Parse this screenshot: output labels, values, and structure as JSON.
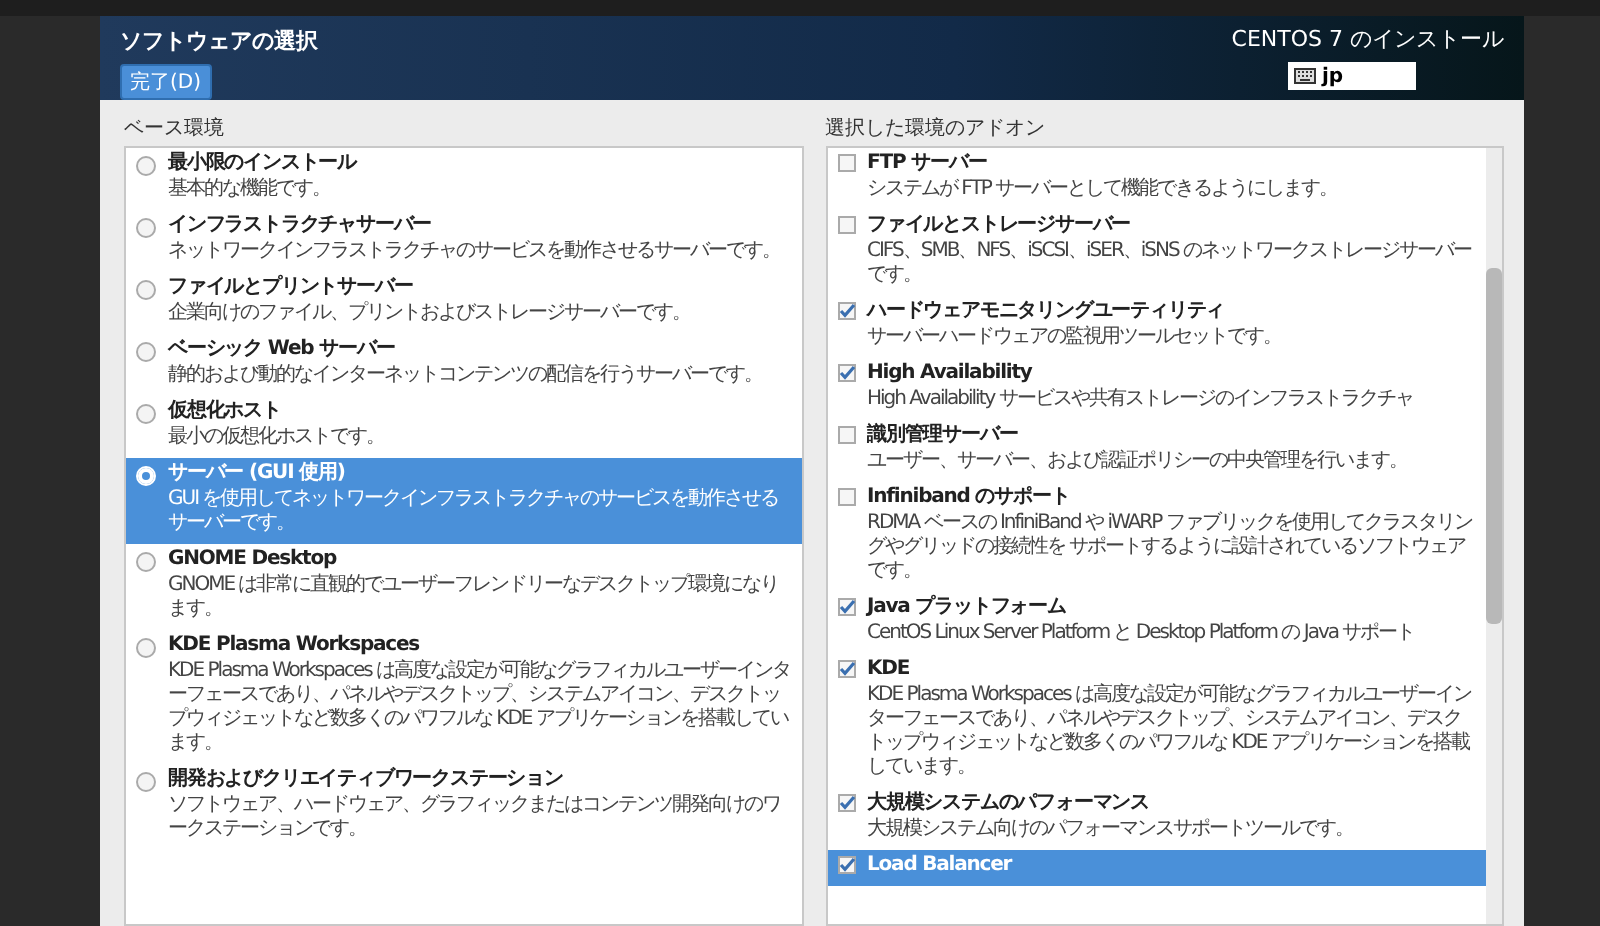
{
  "header": {
    "title": "ソフトウェアの選択",
    "done_button": "完了(D)",
    "install_title": "CENTOS 7 のインストール",
    "keyboard_layout": "jp"
  },
  "base_environment": {
    "heading": "ベース環境",
    "items": [
      {
        "name": "最小限のインストール",
        "description": "基本的な機能です。",
        "selected": false
      },
      {
        "name": "インフラストラクチャサーバー",
        "description": "ネットワークインフラストラクチャのサービスを動作させるサーバーです。",
        "selected": false
      },
      {
        "name": "ファイルとプリントサーバー",
        "description": "企業向けのファイル、プリントおよびストレージサーバーです。",
        "selected": false
      },
      {
        "name": "ベーシック Web サーバー",
        "description": "静的および動的なインターネットコンテンツの配信を行うサーバーです。",
        "selected": false
      },
      {
        "name": "仮想化ホスト",
        "description": "最小の仮想化ホストです。",
        "selected": false
      },
      {
        "name": "サーバー (GUI 使用)",
        "description": "GUI を使用してネットワークインフラストラクチャのサービスを動作させるサーバーです。",
        "selected": true
      },
      {
        "name": "GNOME Desktop",
        "description": "GNOME は非常に直観的でユーザーフレンドリーなデスクトップ環境になります。",
        "selected": false
      },
      {
        "name": "KDE Plasma Workspaces",
        "description": "KDE Plasma Workspaces は高度な設定が可能なグラフィカルユーザーインターフェースであり、パネルやデスクトップ、システムアイコン、デスクトップウィジェットなど数多くのパワフルな KDE アプリケーションを搭載しています。",
        "selected": false
      },
      {
        "name": "開発およびクリエイティブワークステーション",
        "description": "ソフトウェア、ハードウェア、グラフィックまたはコンテンツ開発向けのワークステーションです。",
        "selected": false
      }
    ]
  },
  "addons": {
    "heading": "選択した環境のアドオン",
    "items": [
      {
        "name": "FTP サーバー",
        "description": "システムが FTP サーバーとして機能できるようにします。",
        "checked": false,
        "selected": false
      },
      {
        "name": "ファイルとストレージサーバー",
        "description": "CIFS、SMB、NFS、iSCSI、iSER、iSNS のネットワークストレージサーバーです。",
        "checked": false,
        "selected": false
      },
      {
        "name": "ハードウェアモニタリングユーティリティ",
        "description": "サーバーハードウェアの監視用ツールセットです。",
        "checked": true,
        "selected": false
      },
      {
        "name": "High Availability",
        "description": "High Availability サービスや共有ストレージのインフラストラクチャ",
        "checked": true,
        "selected": false
      },
      {
        "name": "識別管理サーバー",
        "description": "ユーザー、サーバー、および認証ポリシーの中央管理を行います。",
        "checked": false,
        "selected": false
      },
      {
        "name": "Infiniband のサポート",
        "description": "RDMA ベースの InfiniBand や iWARP ファブリックを使用してクラスタリングやグリッドの接続性を サポートするように設計されているソフトウェアです。",
        "checked": false,
        "selected": false
      },
      {
        "name": "Java プラットフォーム",
        "description": "CentOS Linux Server Platform と Desktop Platform の Java サポート",
        "checked": true,
        "selected": false
      },
      {
        "name": "KDE",
        "description": "KDE Plasma Workspaces は高度な設定が可能なグラフィカルユーザーインターフェースであり、パネルやデスクトップ、システムアイコン、デスクトップウィジェットなど数多くのパワフルな KDE アプリケーションを搭載しています。",
        "checked": true,
        "selected": false
      },
      {
        "name": "大規模システムのパフォーマンス",
        "description": "大規模システム向けのパフォーマンスサポートツールです。",
        "checked": true,
        "selected": false
      },
      {
        "name": "Load Balancer",
        "checked": true,
        "selected": true
      }
    ]
  }
}
